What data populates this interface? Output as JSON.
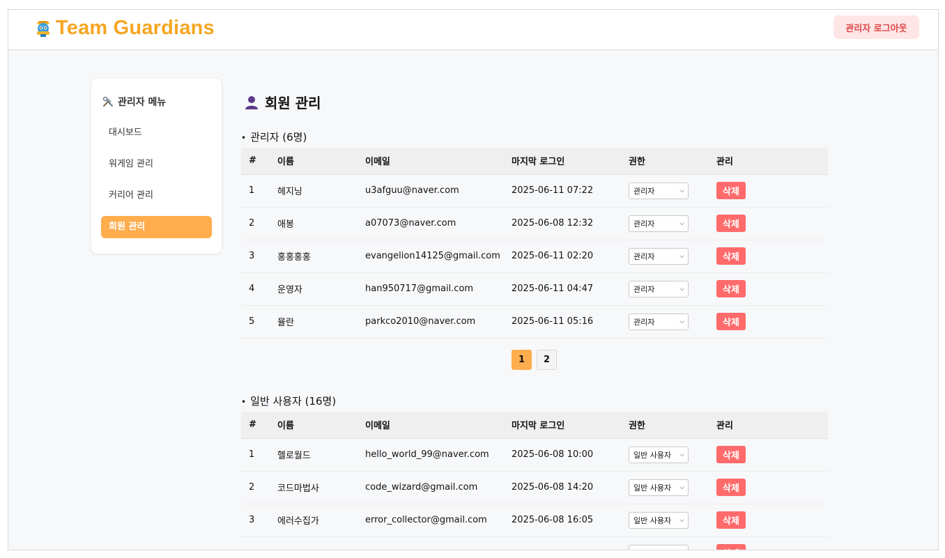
{
  "header": {
    "logo_text": "Team Guardians",
    "logout_label": "관리자 로그아웃"
  },
  "sidebar": {
    "title": "관리자 메뉴",
    "items": [
      {
        "label": "대시보드",
        "active": false
      },
      {
        "label": "워게임 관리",
        "active": false
      },
      {
        "label": "커리어 관리",
        "active": false
      },
      {
        "label": "회원 관리",
        "active": true
      }
    ]
  },
  "main": {
    "title": "회원 관리",
    "columns": [
      "#",
      "이름",
      "이메일",
      "마지막 로그인",
      "권한",
      "관리"
    ],
    "delete_label": "삭제",
    "admins": {
      "section_title": "관리자 (6명)",
      "rows": [
        {
          "no": "1",
          "name": "헤지닝",
          "email": "u3afguu@naver.com",
          "last_login": "2025-06-11 07:22",
          "role": "관리자"
        },
        {
          "no": "2",
          "name": "애봉",
          "email": "a07073@naver.com",
          "last_login": "2025-06-08 12:32",
          "role": "관리자"
        },
        {
          "no": "3",
          "name": "홍홍홍홍",
          "email": "evangelion14125@gmail.com",
          "last_login": "2025-06-11 02:20",
          "role": "관리자"
        },
        {
          "no": "4",
          "name": "운영자",
          "email": "han950717@gmail.com",
          "last_login": "2025-06-11 04:47",
          "role": "관리자"
        },
        {
          "no": "5",
          "name": "뮬란",
          "email": "parkco2010@naver.com",
          "last_login": "2025-06-11 05:16",
          "role": "관리자"
        }
      ],
      "pages": [
        "1",
        "2"
      ],
      "current_page": "1"
    },
    "users": {
      "section_title": "일반 사용자 (16명)",
      "rows": [
        {
          "no": "1",
          "name": "헬로월드",
          "email": "hello_world_99@naver.com",
          "last_login": "2025-06-08 10:00",
          "role": "일반 사용자"
        },
        {
          "no": "2",
          "name": "코드마법사",
          "email": "code_wizard@gmail.com",
          "last_login": "2025-06-08 14:20",
          "role": "일반 사용자"
        },
        {
          "no": "3",
          "name": "에러수집가",
          "email": "error_collector@gmail.com",
          "last_login": "2025-06-08 16:05",
          "role": "일반 사용자"
        }
      ]
    }
  },
  "colors": {
    "brand": "#f5a623",
    "accent": "#ffad4d",
    "danger": "#ff6b6b",
    "logout_bg": "#ffe6e6"
  },
  "icons": {
    "logo": "guardian-mascot-icon",
    "sidebar_title": "tools-icon",
    "page_title": "user-silhouette-icon",
    "select": "chevron-down-icon"
  }
}
